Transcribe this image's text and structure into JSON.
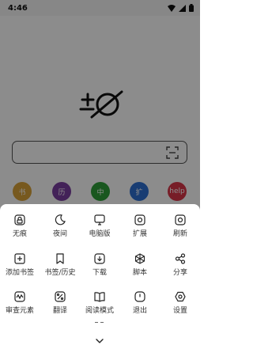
{
  "status": {
    "time": "4:46"
  },
  "search": {
    "placeholder": ""
  },
  "quick_links": [
    {
      "label": "书",
      "color": "#d9a23a"
    },
    {
      "label": "历",
      "color": "#7b3fa0"
    },
    {
      "label": "中",
      "color": "#2f9e3a"
    },
    {
      "label": "扩",
      "color": "#2f6fd1"
    },
    {
      "label": "help",
      "color": "#d93548"
    }
  ],
  "menu": [
    {
      "label": "无痕",
      "icon": "incognito-icon"
    },
    {
      "label": "夜间",
      "icon": "moon-icon"
    },
    {
      "label": "电脑版",
      "icon": "desktop-icon"
    },
    {
      "label": "扩展",
      "icon": "extension-icon"
    },
    {
      "label": "刷新",
      "icon": "refresh-icon"
    },
    {
      "label": "添加书签",
      "icon": "bookmark-add-icon"
    },
    {
      "label": "书签/历史",
      "icon": "bookmark-icon"
    },
    {
      "label": "下载",
      "icon": "download-icon"
    },
    {
      "label": "脚本",
      "icon": "script-icon"
    },
    {
      "label": "分享",
      "icon": "share-icon"
    },
    {
      "label": "审查元素",
      "icon": "inspect-icon"
    },
    {
      "label": "翻译",
      "icon": "translate-icon"
    },
    {
      "label": "阅读模式",
      "icon": "reader-icon"
    },
    {
      "label": "退出",
      "icon": "power-icon"
    },
    {
      "label": "设置",
      "icon": "settings-icon"
    }
  ]
}
